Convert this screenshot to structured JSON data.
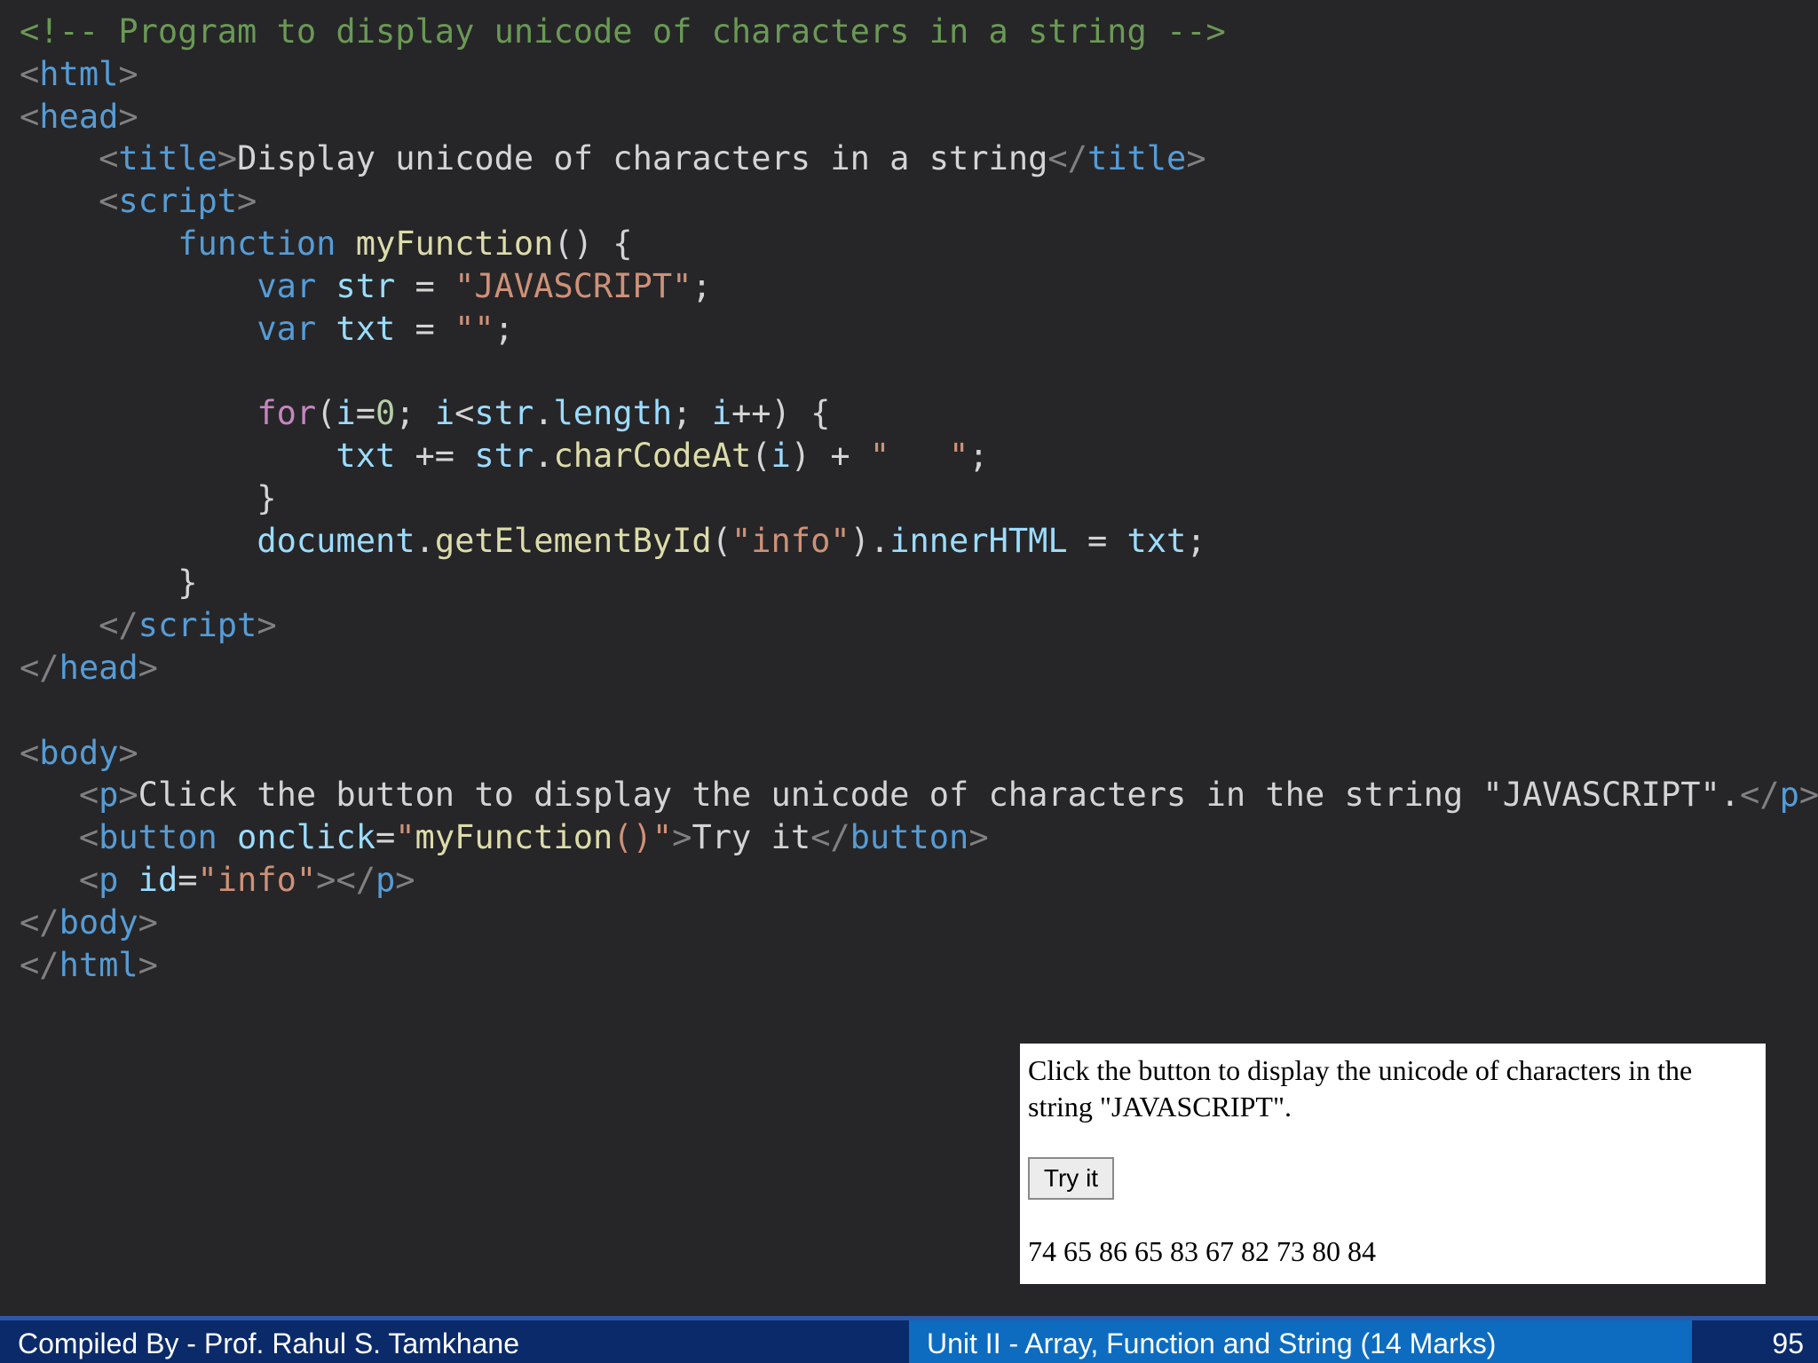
{
  "code_lines": [
    [
      {
        "t": "<!-- Program to display unicode of characters in a string -->",
        "c": "cm"
      }
    ],
    [
      {
        "t": "<",
        "c": "br"
      },
      {
        "t": "html",
        "c": "tg"
      },
      {
        "t": ">",
        "c": "br"
      }
    ],
    [
      {
        "t": "<",
        "c": "br"
      },
      {
        "t": "head",
        "c": "tg"
      },
      {
        "t": ">",
        "c": "br"
      }
    ],
    [
      {
        "t": "    ",
        "c": "pl"
      },
      {
        "t": "<",
        "c": "br"
      },
      {
        "t": "title",
        "c": "tg"
      },
      {
        "t": ">",
        "c": "br"
      },
      {
        "t": "Display unicode of characters in a string",
        "c": "pl"
      },
      {
        "t": "</",
        "c": "br"
      },
      {
        "t": "title",
        "c": "tg"
      },
      {
        "t": ">",
        "c": "br"
      }
    ],
    [
      {
        "t": "    ",
        "c": "pl"
      },
      {
        "t": "<",
        "c": "br"
      },
      {
        "t": "script",
        "c": "tg"
      },
      {
        "t": ">",
        "c": "br"
      }
    ],
    [
      {
        "t": "        ",
        "c": "pl"
      },
      {
        "t": "function",
        "c": "kw"
      },
      {
        "t": " ",
        "c": "pl"
      },
      {
        "t": "myFunction",
        "c": "fn"
      },
      {
        "t": "() {",
        "c": "pl"
      }
    ],
    [
      {
        "t": "            ",
        "c": "pl"
      },
      {
        "t": "var",
        "c": "kw"
      },
      {
        "t": " ",
        "c": "pl"
      },
      {
        "t": "str",
        "c": "vr"
      },
      {
        "t": " = ",
        "c": "pl"
      },
      {
        "t": "\"JAVASCRIPT\"",
        "c": "st"
      },
      {
        "t": ";",
        "c": "pl"
      }
    ],
    [
      {
        "t": "            ",
        "c": "pl"
      },
      {
        "t": "var",
        "c": "kw"
      },
      {
        "t": " ",
        "c": "pl"
      },
      {
        "t": "txt",
        "c": "vr"
      },
      {
        "t": " = ",
        "c": "pl"
      },
      {
        "t": "\"\"",
        "c": "st"
      },
      {
        "t": ";",
        "c": "pl"
      }
    ],
    [
      {
        "t": "",
        "c": "pl"
      }
    ],
    [
      {
        "t": "            ",
        "c": "pl"
      },
      {
        "t": "for",
        "c": "ct"
      },
      {
        "t": "(",
        "c": "pl"
      },
      {
        "t": "i",
        "c": "vr"
      },
      {
        "t": "=",
        "c": "pl"
      },
      {
        "t": "0",
        "c": "nm"
      },
      {
        "t": "; ",
        "c": "pl"
      },
      {
        "t": "i",
        "c": "vr"
      },
      {
        "t": "<",
        "c": "pl"
      },
      {
        "t": "str",
        "c": "vr"
      },
      {
        "t": ".",
        "c": "pl"
      },
      {
        "t": "length",
        "c": "vr"
      },
      {
        "t": "; ",
        "c": "pl"
      },
      {
        "t": "i",
        "c": "vr"
      },
      {
        "t": "++) {",
        "c": "pl"
      }
    ],
    [
      {
        "t": "                ",
        "c": "pl"
      },
      {
        "t": "txt",
        "c": "vr"
      },
      {
        "t": " += ",
        "c": "pl"
      },
      {
        "t": "str",
        "c": "vr"
      },
      {
        "t": ".",
        "c": "pl"
      },
      {
        "t": "charCodeAt",
        "c": "fn"
      },
      {
        "t": "(",
        "c": "pl"
      },
      {
        "t": "i",
        "c": "vr"
      },
      {
        "t": ") + ",
        "c": "pl"
      },
      {
        "t": "\"   \"",
        "c": "st"
      },
      {
        "t": ";",
        "c": "pl"
      }
    ],
    [
      {
        "t": "            }",
        "c": "pl"
      }
    ],
    [
      {
        "t": "            ",
        "c": "pl"
      },
      {
        "t": "document",
        "c": "vr"
      },
      {
        "t": ".",
        "c": "pl"
      },
      {
        "t": "getElementById",
        "c": "fn"
      },
      {
        "t": "(",
        "c": "pl"
      },
      {
        "t": "\"info\"",
        "c": "st"
      },
      {
        "t": ").",
        "c": "pl"
      },
      {
        "t": "innerHTML",
        "c": "vr"
      },
      {
        "t": " = ",
        "c": "pl"
      },
      {
        "t": "txt",
        "c": "vr"
      },
      {
        "t": ";",
        "c": "pl"
      }
    ],
    [
      {
        "t": "        }",
        "c": "pl"
      }
    ],
    [
      {
        "t": "    ",
        "c": "pl"
      },
      {
        "t": "</",
        "c": "br"
      },
      {
        "t": "script",
        "c": "tg"
      },
      {
        "t": ">",
        "c": "br"
      }
    ],
    [
      {
        "t": "</",
        "c": "br"
      },
      {
        "t": "head",
        "c": "tg"
      },
      {
        "t": ">",
        "c": "br"
      }
    ],
    [
      {
        "t": "",
        "c": "pl"
      }
    ],
    [
      {
        "t": "<",
        "c": "br"
      },
      {
        "t": "body",
        "c": "tg"
      },
      {
        "t": ">",
        "c": "br"
      }
    ],
    [
      {
        "t": "   ",
        "c": "pl"
      },
      {
        "t": "<",
        "c": "br"
      },
      {
        "t": "p",
        "c": "tg"
      },
      {
        "t": ">",
        "c": "br"
      },
      {
        "t": "Click the button to display the unicode of characters in the string \"JAVASCRIPT\".",
        "c": "pl"
      },
      {
        "t": "</",
        "c": "br"
      },
      {
        "t": "p",
        "c": "tg"
      },
      {
        "t": ">",
        "c": "br"
      }
    ],
    [
      {
        "t": "   ",
        "c": "pl"
      },
      {
        "t": "<",
        "c": "br"
      },
      {
        "t": "button",
        "c": "tg"
      },
      {
        "t": " ",
        "c": "pl"
      },
      {
        "t": "onclick",
        "c": "vr"
      },
      {
        "t": "=",
        "c": "pl"
      },
      {
        "t": "\"",
        "c": "st"
      },
      {
        "t": "myFunction",
        "c": "fn"
      },
      {
        "t": "()",
        "c": "st"
      },
      {
        "t": "\"",
        "c": "st"
      },
      {
        "t": ">",
        "c": "br"
      },
      {
        "t": "Try it",
        "c": "pl"
      },
      {
        "t": "</",
        "c": "br"
      },
      {
        "t": "button",
        "c": "tg"
      },
      {
        "t": ">",
        "c": "br"
      }
    ],
    [
      {
        "t": "   ",
        "c": "pl"
      },
      {
        "t": "<",
        "c": "br"
      },
      {
        "t": "p",
        "c": "tg"
      },
      {
        "t": " ",
        "c": "pl"
      },
      {
        "t": "id",
        "c": "vr"
      },
      {
        "t": "=",
        "c": "pl"
      },
      {
        "t": "\"info\"",
        "c": "st"
      },
      {
        "t": "></",
        "c": "br"
      },
      {
        "t": "p",
        "c": "tg"
      },
      {
        "t": ">",
        "c": "br"
      }
    ],
    [
      {
        "t": "</",
        "c": "br"
      },
      {
        "t": "body",
        "c": "tg"
      },
      {
        "t": ">",
        "c": "br"
      }
    ],
    [
      {
        "t": "</",
        "c": "br"
      },
      {
        "t": "html",
        "c": "tg"
      },
      {
        "t": ">",
        "c": "br"
      }
    ]
  ],
  "output": {
    "paragraph": "Click the button to display the unicode of characters in the string \"JAVASCRIPT\".",
    "button_label": "Try it",
    "result": "74 65 86 65 83 67 82 73 80 84"
  },
  "footer": {
    "left": "Compiled By - Prof. Rahul S. Tamkhane",
    "middle": "Unit II - Array, Function and String (14 Marks)",
    "page": "95"
  },
  "colors": {
    "background": "#262628",
    "comment": "#6a9955",
    "tag": "#569cd6",
    "string": "#ce9178",
    "function": "#dcdcaa",
    "variable": "#9cdcfe",
    "footer_dark": "#0a2a6a",
    "footer_blue": "#0d6cc0"
  }
}
